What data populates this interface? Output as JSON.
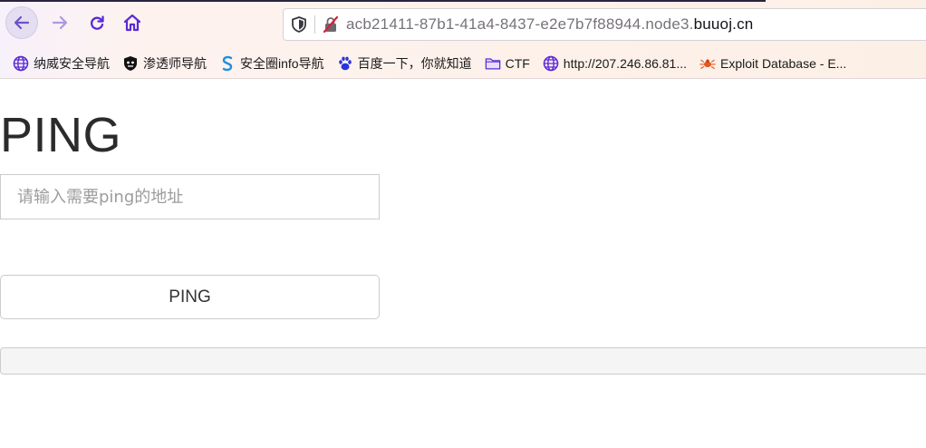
{
  "browser": {
    "nav": {
      "back_icon": "arrow-left-icon",
      "forward_icon": "arrow-right-icon",
      "reload_icon": "reload-icon",
      "home_icon": "home-icon"
    },
    "url": {
      "prefix": "acb21411-87b1-41a4-8437-e2e7b7f88944.node3.",
      "host": "buuoj.cn"
    },
    "bookmarks": [
      {
        "label": "纳威安全导航",
        "icon": "globe-icon"
      },
      {
        "label": "渗透师导航",
        "icon": "shield-face-icon"
      },
      {
        "label": "安全圈info导航",
        "icon": "s-logo-icon"
      },
      {
        "label": "百度一下，你就知道",
        "icon": "baidu-paw-icon"
      },
      {
        "label": "CTF",
        "icon": "folder-icon"
      },
      {
        "label": "http://207.246.86.81...",
        "icon": "globe-icon"
      },
      {
        "label": "Exploit Database - E...",
        "icon": "bug-icon"
      }
    ],
    "colors": {
      "accent": "#5b2bd6",
      "insecure": "#d2233c"
    }
  },
  "page": {
    "title": "PING",
    "input": {
      "placeholder": "请输入需要ping的地址",
      "value": ""
    },
    "button_label": "PING",
    "result": ""
  }
}
